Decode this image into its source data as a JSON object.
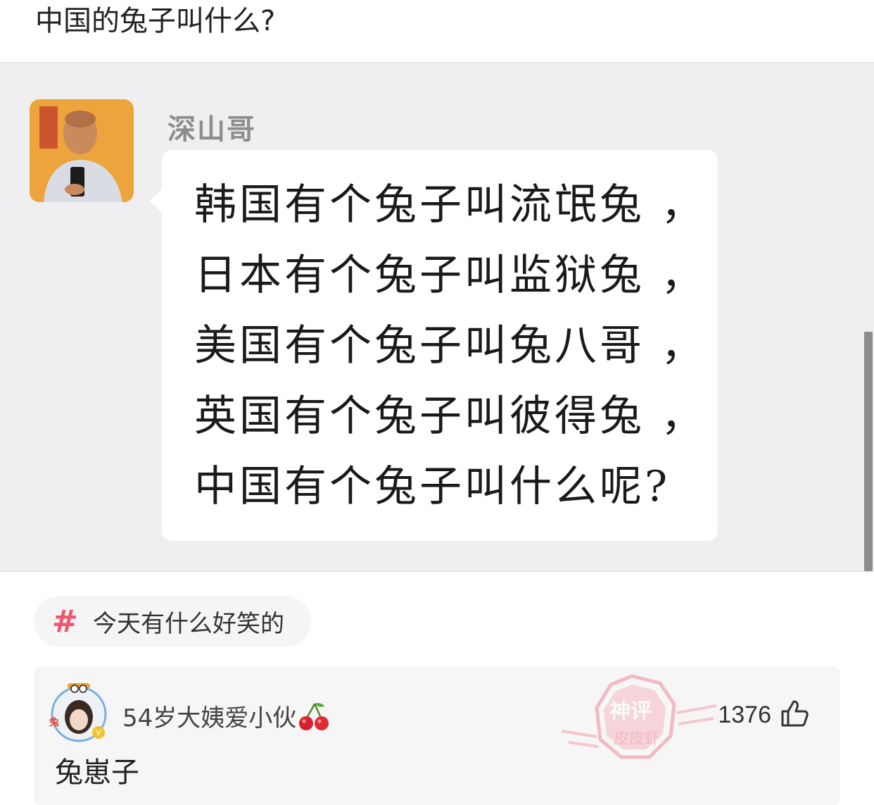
{
  "post": {
    "title": "中国的兔子叫什么?"
  },
  "chat_image": {
    "sender_name": "深山哥",
    "message_lines": [
      "韩国有个兔子叫流氓兔 ，",
      "日本有个兔子叫监狱兔 ，",
      "美国有个兔子叫兔八哥 ，",
      "英国有个兔子叫彼得兔 ，",
      "中国有个兔子叫什么呢?"
    ]
  },
  "topic": {
    "icon": "hash-icon",
    "label": "今天有什么好笑的"
  },
  "comment": {
    "username": "54岁大姨爱小伙",
    "username_emoji": "cherry-icon",
    "text": "兔崽子",
    "like_count": "1376",
    "like_icon": "thumbs-up-icon",
    "watermark_text": "神评",
    "watermark_subtext": "皮皮虾"
  },
  "colors": {
    "accent": "#f0576e",
    "image_bg": "#efeff1",
    "card_bg": "#f6f6f7"
  }
}
